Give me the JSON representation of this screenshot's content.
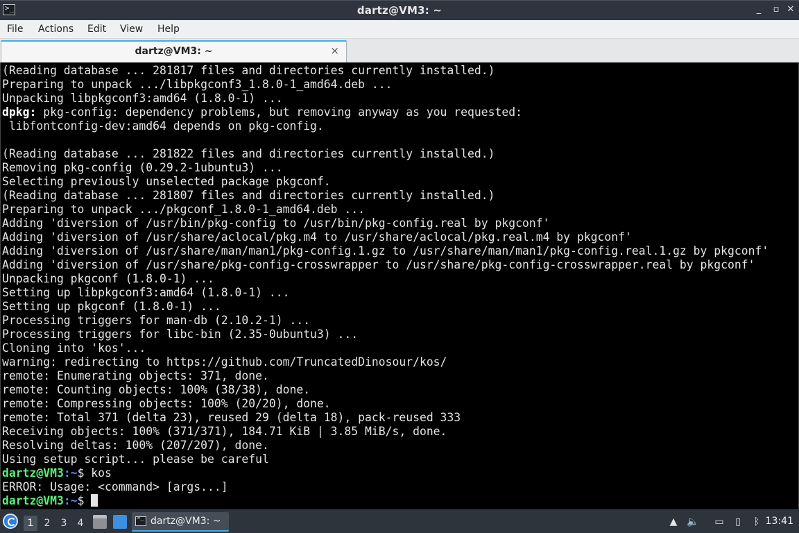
{
  "window": {
    "title": "dartz@VM3: ~",
    "minimize_glyph": "_",
    "maximize_glyph": "▫",
    "close_glyph": "✕",
    "icon": "terminal-icon"
  },
  "menu": {
    "items": [
      "File",
      "Actions",
      "Edit",
      "View",
      "Help"
    ]
  },
  "tabs": [
    {
      "label": "dartz@VM3: ~",
      "close_glyph": "×"
    }
  ],
  "terminal": {
    "lines": [
      "(Reading database ... 281817 files and directories currently installed.)",
      "Preparing to unpack .../libpkgconf3_1.8.0-1_amd64.deb ...",
      "Unpacking libpkgconf3:amd64 (1.8.0-1) ...",
      {
        "bold": "dpkg:",
        "text": " pkg-config: dependency problems, but removing anyway as you requested:"
      },
      " libfontconfig-dev:amd64 depends on pkg-config.",
      "",
      "(Reading database ... 281822 files and directories currently installed.)",
      "Removing pkg-config (0.29.2-1ubuntu3) ...",
      "Selecting previously unselected package pkgconf.",
      "(Reading database ... 281807 files and directories currently installed.)",
      "Preparing to unpack .../pkgconf_1.8.0-1_amd64.deb ...",
      "Adding 'diversion of /usr/bin/pkg-config to /usr/bin/pkg-config.real by pkgconf'",
      "Adding 'diversion of /usr/share/aclocal/pkg.m4 to /usr/share/aclocal/pkg.real.m4 by pkgconf'",
      "Adding 'diversion of /usr/share/man/man1/pkg-config.1.gz to /usr/share/man/man1/pkg-config.real.1.gz by pkgconf'",
      "Adding 'diversion of /usr/share/pkg-config-crosswrapper to /usr/share/pkg-config-crosswrapper.real by pkgconf'",
      "Unpacking pkgconf (1.8.0-1) ...",
      "Setting up libpkgconf3:amd64 (1.8.0-1) ...",
      "Setting up pkgconf (1.8.0-1) ...",
      "Processing triggers for man-db (2.10.2-1) ...",
      "Processing triggers for libc-bin (2.35-0ubuntu3) ...",
      "Cloning into 'kos'...",
      "warning: redirecting to https://github.com/TruncatedDinosour/kos/",
      "remote: Enumerating objects: 371, done.",
      "remote: Counting objects: 100% (38/38), done.",
      "remote: Compressing objects: 100% (20/20), done.",
      "remote: Total 371 (delta 23), reused 29 (delta 18), pack-reused 333",
      "Receiving objects: 100% (371/371), 184.71 KiB | 3.85 MiB/s, done.",
      "Resolving deltas: 100% (207/207), done.",
      "Using setup script... please be careful",
      {
        "prompt_user": "dartz@VM3",
        "prompt_path": ":~",
        "text": "$ kos"
      },
      "ERROR: Usage: <command> [args...]",
      {
        "prompt_user": "dartz@VM3",
        "prompt_path": ":~",
        "text": "$ ",
        "cursor": true
      }
    ]
  },
  "taskbar": {
    "start_icon": "start-menu-icon",
    "desktops": [
      "1",
      "2",
      "3",
      "4"
    ],
    "active_desktop": "1",
    "quicklaunch": [
      "file-manager-icon",
      "show-desktop-icon"
    ],
    "tasks": [
      {
        "label": "dartz@VM3: ~",
        "icon": "terminal-icon"
      }
    ],
    "tray": [
      "arrow-up-icon",
      "volume-icon",
      "network-icon",
      "clipboard-icon",
      "bluetooth-icon"
    ],
    "clock": "13:41"
  }
}
